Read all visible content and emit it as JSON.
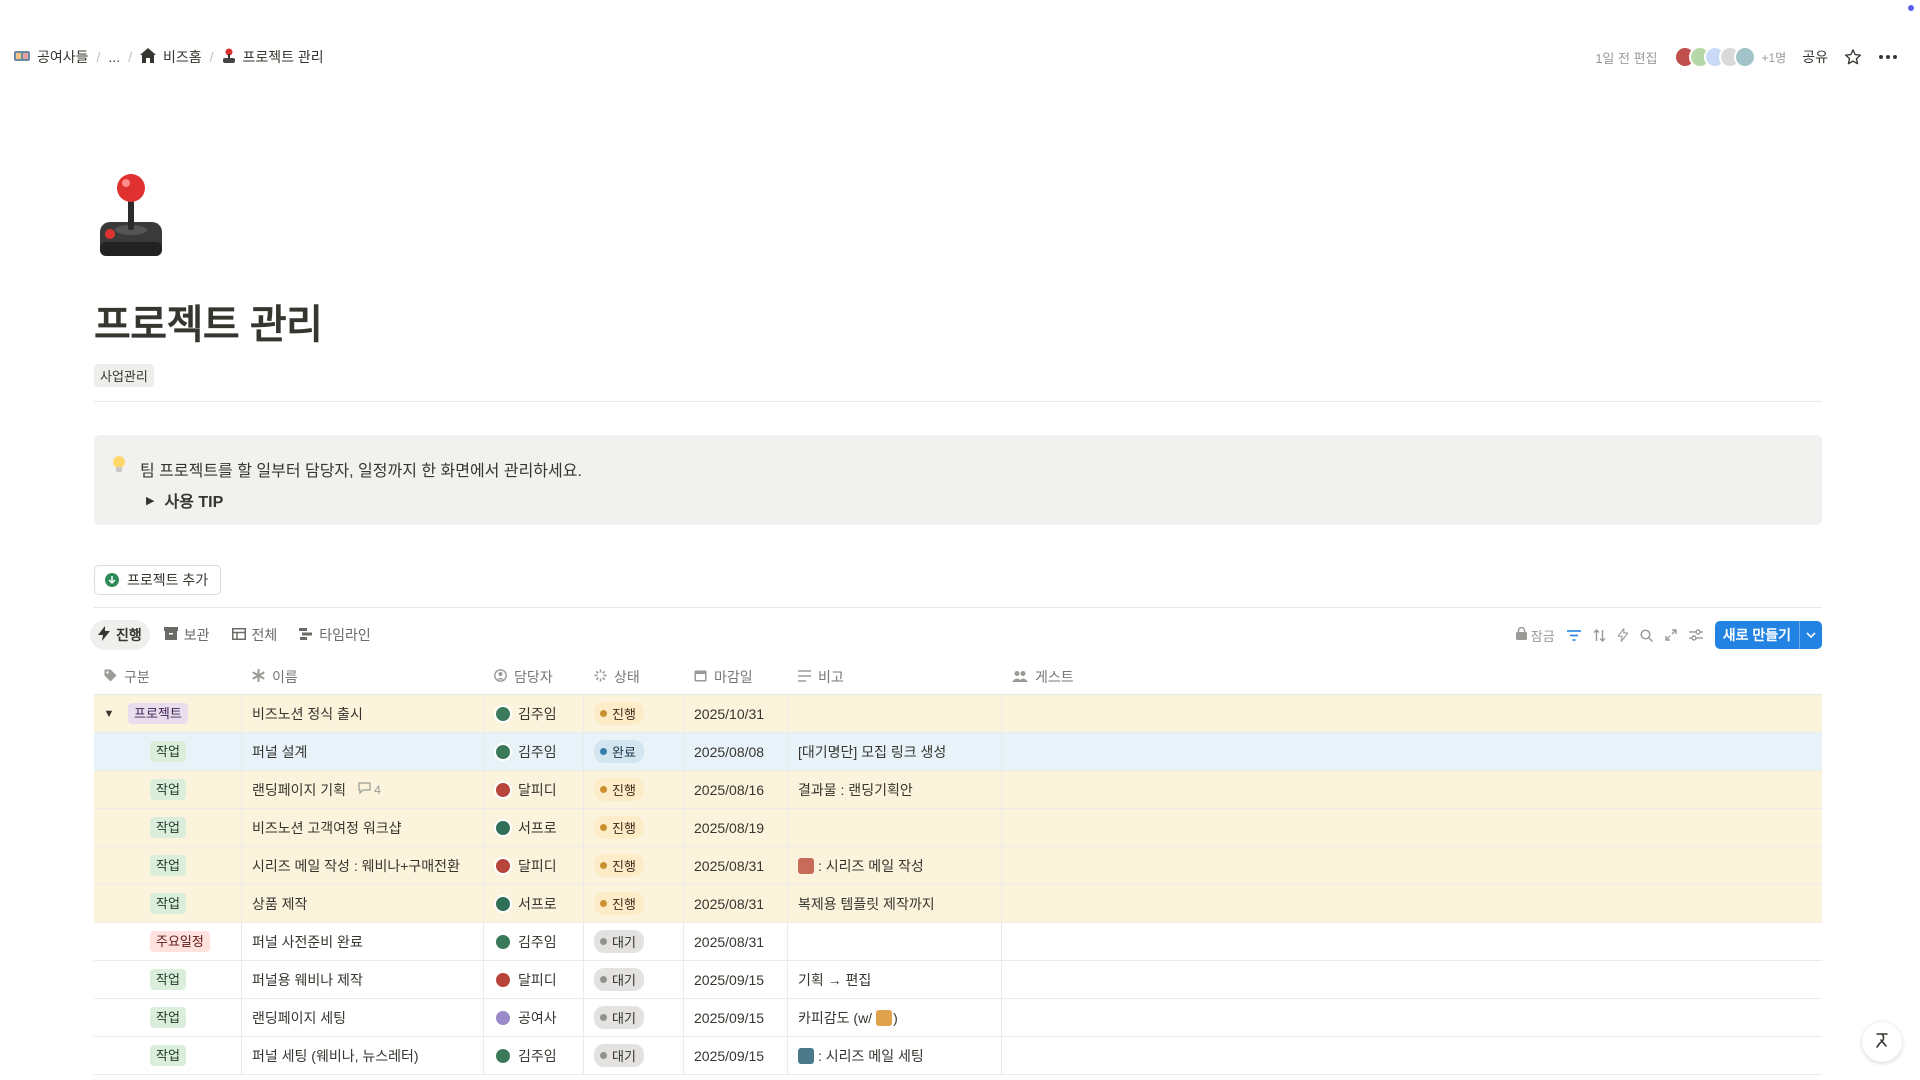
{
  "breadcrumb": {
    "items": [
      "공여사들",
      "...",
      "비즈홈",
      "프로젝트 관리"
    ]
  },
  "topbar": {
    "edited": "1일 전 편집",
    "more_people": "+1명",
    "share": "공유"
  },
  "page": {
    "title": "프로젝트 관리",
    "tag": "사업관리",
    "callout_text": "팀 프로젝트를 할 일부터 담당자, 일정까지 한 화면에서 관리하세요.",
    "toggle_label": "사용 TIP",
    "add_button": "프로젝트 추가"
  },
  "views": [
    "진행",
    "보관",
    "전체",
    "타임라인"
  ],
  "toolbar": {
    "lock": "잠금",
    "new_button": "새로 만들기"
  },
  "table": {
    "columns": [
      "구분",
      "이름",
      "담당자",
      "상태",
      "마감일",
      "비고",
      "게스트"
    ],
    "rows": [
      {
        "kind": "프로젝트",
        "name": "비즈노션 정식 출시",
        "owner": "김주임",
        "status": "진행",
        "due": "2025/10/31",
        "note": "",
        "guest": ""
      },
      {
        "kind": "작업",
        "name": "퍼널 설계",
        "owner": "김주임",
        "status": "완료",
        "due": "2025/08/08",
        "note": "[대기명단] 모집 링크 생성",
        "guest": ""
      },
      {
        "kind": "작업",
        "name": "랜딩페이지 기획",
        "comments": "4",
        "owner": "달피디",
        "status": "진행",
        "due": "2025/08/16",
        "note": "결과물 : 랜딩기획안",
        "guest": ""
      },
      {
        "kind": "작업",
        "name": "비즈노션 고객여정 워크샵",
        "owner": "서프로",
        "status": "진행",
        "due": "2025/08/19",
        "note": "",
        "guest": ""
      },
      {
        "kind": "작업",
        "name": "시리즈 메일 작성 : 웨비나+구매전환",
        "owner": "달피디",
        "status": "진행",
        "due": "2025/08/31",
        "note": ": 시리즈 메일 작성",
        "guest": ""
      },
      {
        "kind": "작업",
        "name": "상품 제작",
        "owner": "서프로",
        "status": "진행",
        "due": "2025/08/31",
        "note": "복제용 템플릿 제작까지",
        "guest": ""
      },
      {
        "kind": "주요일정",
        "name": "퍼널 사전준비 완료",
        "owner": "김주임",
        "status": "대기",
        "due": "2025/08/31",
        "note": "",
        "guest": ""
      },
      {
        "kind": "작업",
        "name": "퍼널용 웨비나 제작",
        "owner": "달피디",
        "status": "대기",
        "due": "2025/09/15",
        "note": "기획 → 편집",
        "guest": ""
      },
      {
        "kind": "작업",
        "name": "랜딩페이지 세팅",
        "owner": "공여사",
        "status": "대기",
        "due": "2025/09/15",
        "note": "카피감도 (w/",
        "note_suffix": ")",
        "guest": ""
      },
      {
        "kind": "작업",
        "name": "퍼널 세팅 (웨비나, 뉴스레터)",
        "owner": "김주임",
        "status": "대기",
        "due": "2025/09/15",
        "note": ": 시리즈 메일 세팅",
        "guest": ""
      }
    ]
  },
  "colors": {
    "accent": "#2383e2",
    "row_in_progress": "#fbf3db",
    "row_done": "#e7f3f8"
  }
}
